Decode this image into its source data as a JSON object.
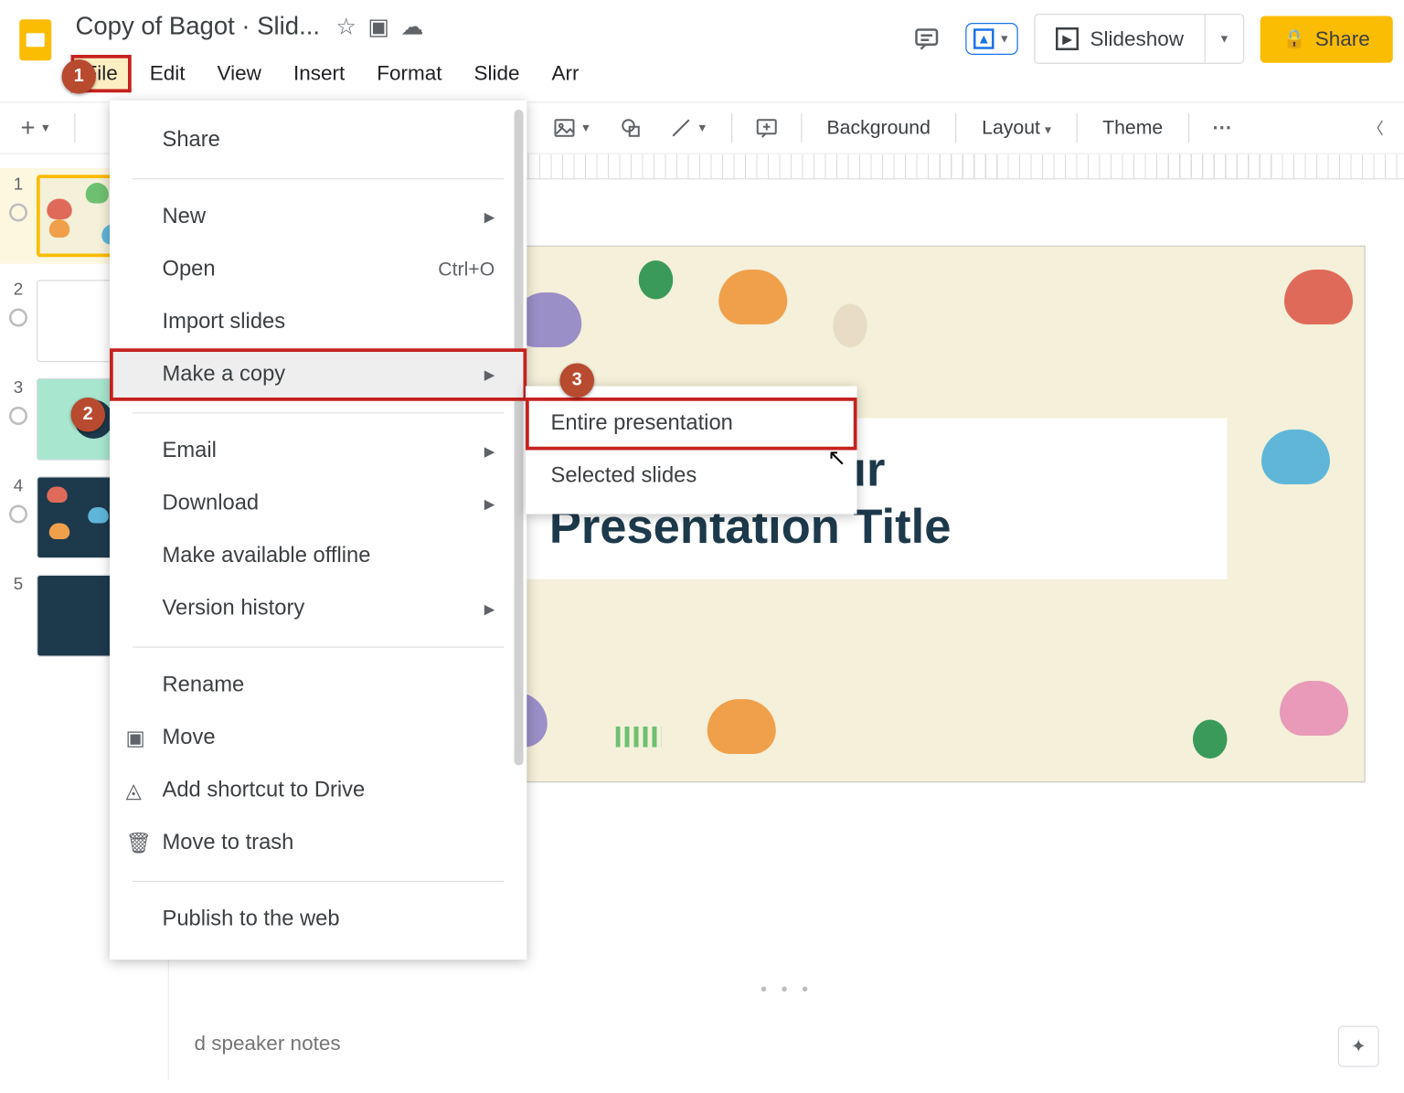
{
  "doc_title": "Copy of Bagot · Slid...",
  "menubar": [
    "File",
    "Edit",
    "View",
    "Insert",
    "Format",
    "Slide",
    "Arr"
  ],
  "hdr": {
    "slideshow": "Slideshow",
    "share": "Share"
  },
  "toolbar": {
    "background": "Background",
    "layout": "Layout",
    "theme": "Theme"
  },
  "file_menu": {
    "share": "Share",
    "new": "New",
    "open": "Open",
    "open_kbd": "Ctrl+O",
    "import": "Import slides",
    "copy": "Make a copy",
    "email": "Email",
    "download": "Download",
    "offline": "Make available offline",
    "version": "Version history",
    "rename": "Rename",
    "move": "Move",
    "shortcut": "Add shortcut to Drive",
    "trash": "Move to trash",
    "publish": "Publish to the web"
  },
  "submenu": {
    "entire": "Entire presentation",
    "selected": "Selected slides"
  },
  "slide": {
    "title_l1": "This is Your",
    "title_l2": "Presentation Title"
  },
  "notes_placeholder": "d speaker notes",
  "thumbnails": [
    1,
    2,
    3,
    4,
    5
  ],
  "badges": {
    "b1": "1",
    "b2": "2",
    "b3": "3"
  }
}
